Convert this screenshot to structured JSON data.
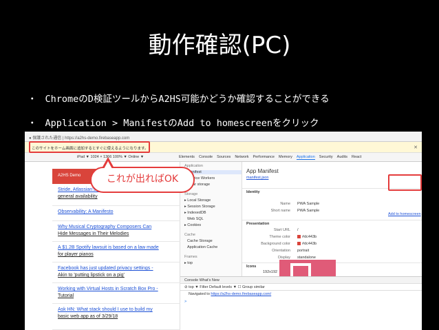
{
  "slide": {
    "title": "動作確認(PC)",
    "bullets": [
      "ChromeのD検証ツールからA2HS可能かどうか確認することができる",
      "Application > ManifestのAdd to homescreenをクリック"
    ],
    "bullet_mark": "・"
  },
  "screenshot": {
    "urlbar": "● 保護された通信 | https://a2hs-demo.firebaseapp.com",
    "infobar": "このサイトをホーム画面に追加するとすぐに使えるようになります。",
    "toolbar_left": "iPad ▼  1024 × 1366  100% ▼  Online ▼",
    "devtools_tabs": [
      "Elements",
      "Console",
      "Sources",
      "Network",
      "Performance",
      "Memory",
      "Application",
      "Security",
      "Audits",
      "React"
    ],
    "page": {
      "header": "A2HS Demo",
      "articles": [
        {
          "link": "Stride, Atlassian's ...",
          "sub": "general availability"
        },
        {
          "link": "Observability: A Manifesto",
          "sub": ""
        },
        {
          "link": "Why Musical Cryptography Composers Can",
          "sub": "Hide Messages in Their Melodies"
        },
        {
          "link": "A $1.2B Spotify lawsuit is based on a law made",
          "sub": "for player pianos"
        },
        {
          "link": "Facebook has just updated privacy settings -",
          "sub": "Akin to 'putting lipstick on a pig'"
        },
        {
          "link": "Working with Virtual Hosts in Scratch Box Pro -",
          "sub": "Tutorial"
        },
        {
          "link": "Ask HN: What stack should I use to build my",
          "sub": "basic web app as of 3/29/18"
        }
      ]
    },
    "sidebar": {
      "application_head": "Application",
      "application_items": [
        "Manifest",
        "Service Workers",
        "Clear storage"
      ],
      "storage_head": "Storage",
      "storage_items": [
        "▸ Local Storage",
        "▸ Session Storage",
        "▸ IndexedDB",
        "Web SQL",
        "▸ Cookies"
      ],
      "cache_head": "Cache",
      "cache_items": [
        "Cache Storage",
        "Application Cache"
      ],
      "frames_head": "Frames",
      "frames_items": [
        "▸ top"
      ]
    },
    "manifest": {
      "title": "App Manifest",
      "link": "manifest.json",
      "identity_label": "Identity",
      "add_homescreen": "Add to homescreen",
      "rows_identity": [
        {
          "label": "Name",
          "value": "PWA Sample"
        },
        {
          "label": "Short name",
          "value": "PWA Sample"
        }
      ],
      "presentation_label": "Presentation",
      "rows_presentation": [
        {
          "label": "Start URL",
          "value": "/"
        },
        {
          "label": "Theme color",
          "value": "#dc443b"
        },
        {
          "label": "Background color",
          "value": "#dc443b"
        },
        {
          "label": "Orientation",
          "value": "portrait"
        },
        {
          "label": "Display",
          "value": "standalone"
        }
      ],
      "icons_label": "Icons",
      "icon_size": "192x192",
      "theme_hex": "#d9443b"
    },
    "console": {
      "tabs": "Console   What's New",
      "filter": "⊘  top  ▼   Filter                  Default levels ▼   ☐ Group similar",
      "line_prefix": "Navigated to",
      "line_url": "https://a2hs-demo.firebaseapp.com/",
      "prompt": ">"
    },
    "callout": "これが出ればOK"
  },
  "colors": {
    "accent_red": "#e43b3b",
    "link_blue": "#1a4fd6"
  }
}
